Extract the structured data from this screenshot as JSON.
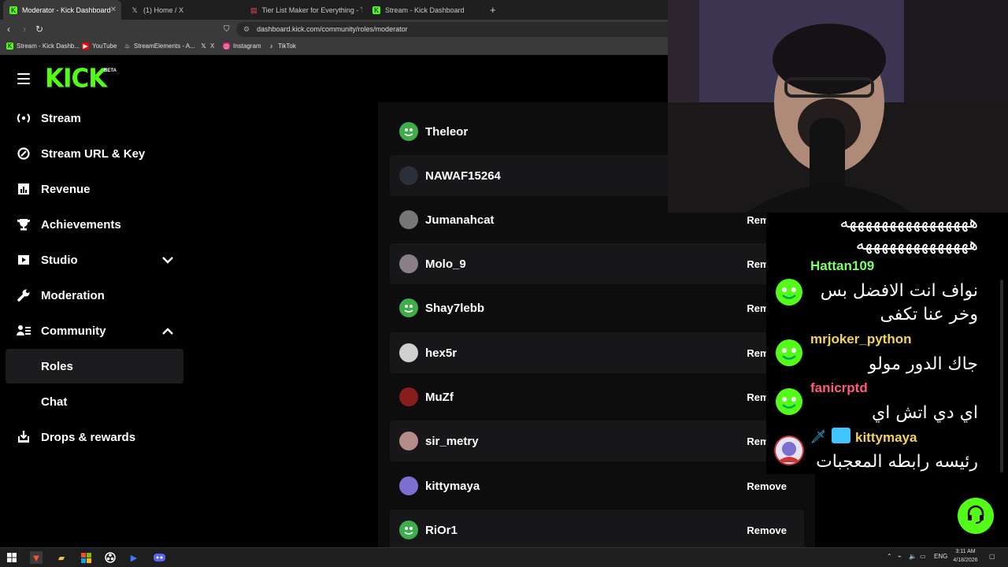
{
  "browser": {
    "tabs": [
      {
        "title": "Moderator - Kick Dashboard",
        "active": true
      },
      {
        "title": "(1) Home / X",
        "active": false
      },
      {
        "title": "Tier List Maker for Everything - TierM",
        "active": false
      },
      {
        "title": "Stream - Kick Dashboard",
        "active": false
      }
    ],
    "url": "dashboard.kick.com/community/roles/moderator",
    "bookmarks": [
      "Stream - Kick Dashb...",
      "YouTube",
      "StreamElements - A...",
      "X",
      "Instagram",
      "TikTok"
    ]
  },
  "header": {
    "logo": "KICK",
    "badge": "BETA"
  },
  "sidebar": {
    "items": [
      {
        "label": "Stream",
        "icon": "broadcast-icon"
      },
      {
        "label": "Stream URL & Key",
        "icon": "link-icon"
      },
      {
        "label": "Revenue",
        "icon": "chart-icon"
      },
      {
        "label": "Achievements",
        "icon": "trophy-icon"
      },
      {
        "label": "Studio",
        "icon": "studio-icon"
      },
      {
        "label": "Moderation",
        "icon": "wrench-icon"
      },
      {
        "label": "Community",
        "icon": "community-icon"
      }
    ],
    "sub_items": [
      {
        "label": "Roles",
        "active": true
      },
      {
        "label": "Chat",
        "active": false
      }
    ],
    "drops": {
      "label": "Drops & rewards",
      "icon": "drops-icon"
    }
  },
  "moderators": {
    "remove_label": "Remove",
    "rows": [
      {
        "name": "Theleor",
        "avatar_color": "#3fae4a"
      },
      {
        "name": "NAWAF15264",
        "avatar_color": "#2b2f3a"
      },
      {
        "name": "Jumanahcat",
        "avatar_color": "#777777"
      },
      {
        "name": "Molo_9",
        "avatar_color": "#8a7f86"
      },
      {
        "name": "Shay7lebb",
        "avatar_color": "#3fae4a"
      },
      {
        "name": "hex5r",
        "avatar_color": "#cfcfcf"
      },
      {
        "name": "MuZf",
        "avatar_color": "#8b1d1d"
      },
      {
        "name": "sir_metry",
        "avatar_color": "#b58d88"
      },
      {
        "name": "kittymaya",
        "avatar_color": "#7b6fd1"
      },
      {
        "name": "RiOr1",
        "avatar_color": "#3fae4a"
      }
    ]
  },
  "chat": {
    "top_lines": [
      "ههههههههههههههههه",
      "ههههههههههههههه"
    ],
    "messages": [
      {
        "user": "Hattan109",
        "user_color": "#7dff6b",
        "lines": [
          "نواف انت الافضل بس",
          "وخر عنا تكفى"
        ]
      },
      {
        "user": "mrjoker_python",
        "user_color": "#f5d35a",
        "lines": [
          "جاك الدور مولو"
        ]
      },
      {
        "user": "fanicrptd",
        "user_color": "#ff5a7a",
        "lines": [
          "اي دي اتش اي"
        ]
      },
      {
        "user": "kittymaya",
        "user_color": "#f5d35a",
        "lines": [
          "رئيسه رابطه المعجبات"
        ]
      }
    ]
  },
  "taskbar": {
    "lang": "ENG",
    "time": "3:11 AM",
    "date": "4/18/2026"
  },
  "colors": {
    "brand": "#53fc18",
    "background": "#000000"
  }
}
